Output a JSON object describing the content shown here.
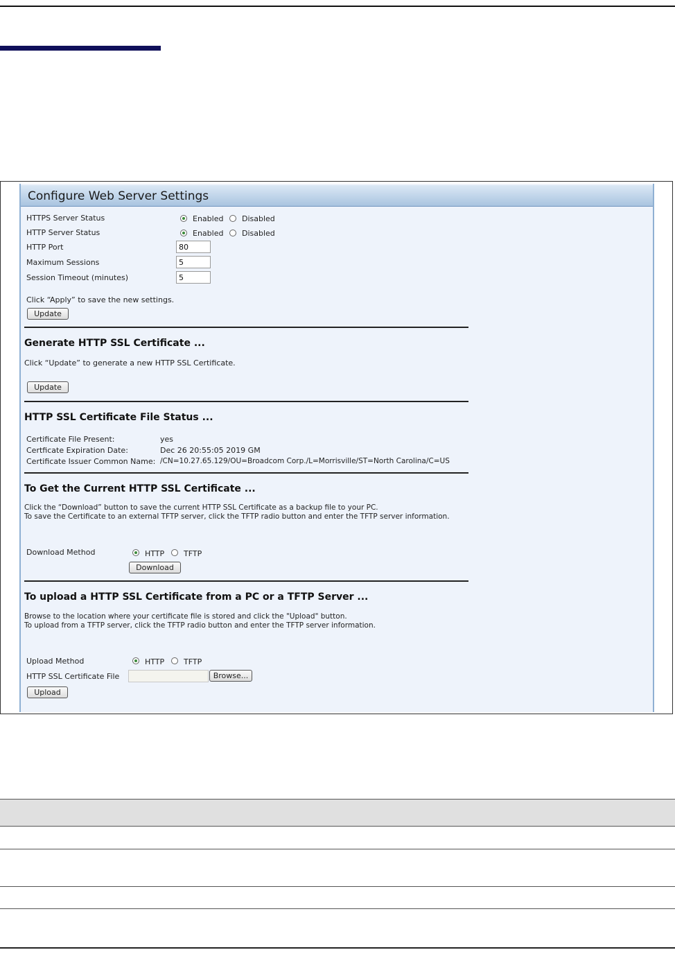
{
  "panel": {
    "title": "Configure Web Server Settings"
  },
  "server": {
    "https_label": "HTTPS Server Status",
    "http_label": "HTTP Server Status",
    "enabled": "Enabled",
    "disabled": "Disabled",
    "https_status": "Enabled",
    "http_status": "Enabled",
    "http_port_label": "HTTP Port",
    "http_port": "80",
    "max_sessions_label": "Maximum Sessions",
    "max_sessions": "5",
    "timeout_label": "Session Timeout (minutes)",
    "timeout": "5",
    "apply_note": "Click “Apply” to save the new settings.",
    "update_button": "Update"
  },
  "generate": {
    "heading": "Generate HTTP SSL Certificate ...",
    "note": "Click “Update” to generate a new HTTP SSL Certificate.",
    "update_button": "Update"
  },
  "status": {
    "heading": "HTTP SSL Certificate File Status ...",
    "present_label": "Certificate File Present:",
    "present_value": "yes",
    "expiration_label": "Certficate Expiration Date:",
    "expiration_value": "Dec 26 20:55:05 2019 GM",
    "issuer_label": "Certificate Issuer Common Name:",
    "issuer_value": "/CN=10.27.65.129/OU=Broadcom Corp./L=Morrisville/ST=North Carolina/C=US"
  },
  "download": {
    "heading": "To Get the Current HTTP SSL Certificate ...",
    "note1": "Click the “Download” button to save the current HTTP SSL Certificate as a backup file to your PC.",
    "note2": "To save the Certificate to an external TFTP server, click the TFTP radio button and enter the TFTP server information.",
    "method_label": "Download Method",
    "http": "HTTP",
    "tftp": "TFTP",
    "selected": "HTTP",
    "button": "Download"
  },
  "upload": {
    "heading": "To upload a HTTP SSL Certificate from a PC or a TFTP Server ...",
    "note1": "Browse to the location where your certificate file is stored and click the \"Upload\" button.",
    "note2": "To upload from a TFTP server, click the TFTP radio button and enter the TFTP server information.",
    "method_label": "Upload Method",
    "http": "HTTP",
    "tftp": "TFTP",
    "selected": "HTTP",
    "file_label": "HTTP SSL Certificate File",
    "file_value": "",
    "browse_button": "Browse...",
    "upload_button": "Upload"
  },
  "colors": {
    "section_bar": "#10105a",
    "panel_bg": "#eef3fb",
    "panel_header": "#a9c4e0",
    "radio_selected": "#3a8a3a",
    "table_header": "#e0e0e0"
  },
  "icons": {
    "radio_on": "radio-selected-icon",
    "radio_off": "radio-empty-icon"
  }
}
